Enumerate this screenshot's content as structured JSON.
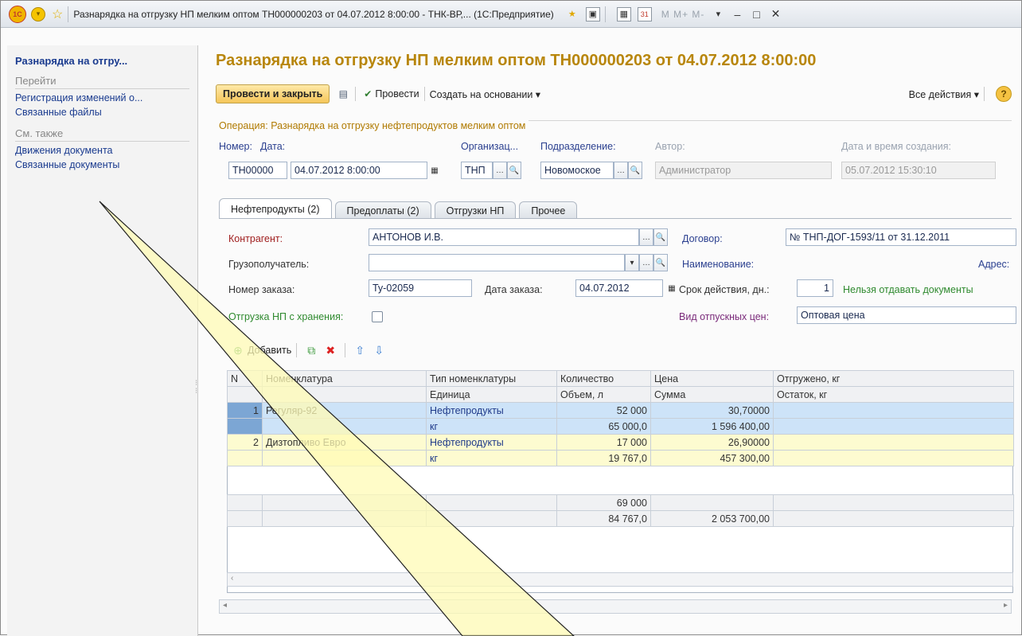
{
  "window": {
    "title": "Разнарядка на отгрузку НП мелким оптом ТН000000203 от 04.07.2012 8:00:00 - ТНК-ВР,... (1С:Предприятие)",
    "memory_buttons": "M  M+  M-",
    "logo": "1С"
  },
  "left_panel": {
    "title": "Разнарядка на отгру...",
    "goto_header": "Перейти",
    "goto_links": [
      "Регистрация изменений о...",
      "Связанные файлы"
    ],
    "see_also_header": "См. также",
    "see_also_links": [
      "Движения документа",
      "Связанные документы"
    ]
  },
  "doc": {
    "title": "Разнарядка на отгрузку НП мелким оптом ТН000000203 от 04.07.2012 8:00:00"
  },
  "toolbar": {
    "post_close": "Провести и закрыть",
    "post": "Провести",
    "create_based": "Создать на основании ▾",
    "all_actions": "Все действия ▾",
    "help": "?"
  },
  "operation": {
    "legend": "Операция: Разнарядка на отгрузку нефтепродуктов мелким оптом",
    "number_label": "Номер:",
    "number_value": "ТН00000",
    "date_label": "Дата:",
    "date_value": "04.07.2012  8:00:00",
    "org_label": "Организац...",
    "org_value": "ТНП",
    "dept_label": "Подразделение:",
    "dept_value": "Новомоское",
    "author_label": "Автор:",
    "author_value": "Администратор",
    "created_label": "Дата и время создания:",
    "created_value": "05.07.2012 15:30:10"
  },
  "tabs": [
    "Нефтепродукты (2)",
    "Предоплаты (2)",
    "Отгрузки НП",
    "Прочее"
  ],
  "form": {
    "counterparty_label": "Контрагент:",
    "counterparty_value": "АНТОНОВ И.В.",
    "contract_label": "Договор:",
    "contract_value": "№ ТНП-ДОГ-1593/11 от 31.12.2011",
    "consignee_label": "Грузополучатель:",
    "consignee_value": "",
    "name_label": "Наименование:",
    "address_label": "Адрес:",
    "order_no_label": "Номер заказа:",
    "order_no_value": "Ту-02059",
    "order_date_label": "Дата заказа:",
    "order_date_value": "04.07.2012",
    "validity_label": "Срок действия, дн.:",
    "validity_value": "1",
    "warning": "Нельзя отдавать документы",
    "storage_label": "Отгрузка НП с хранения:",
    "price_type_label": "Вид отпускных цен:",
    "price_type_value": "Оптовая цена"
  },
  "table_toolbar": {
    "add": "Добавить"
  },
  "grid": {
    "headers_row1": [
      "N",
      "Номенклатура",
      "Тип номенклатуры",
      "Количество",
      "Цена",
      "Отгружено, кг"
    ],
    "headers_row2": [
      "",
      "",
      "Единица",
      "Объем, л",
      "Сумма",
      "Остаток, кг"
    ],
    "rows": [
      {
        "n": "1",
        "item": "Регуляр-92",
        "type": "Нефтепродукты",
        "unit": "кг",
        "qty": "52 000",
        "vol": "65 000,0",
        "price": "30,70000",
        "sum": "1 596 400,00",
        "shipped": "",
        "rest": ""
      },
      {
        "n": "2",
        "item": "Дизтопливо Евро",
        "type": "Нефтепродукты",
        "unit": "кг",
        "qty": "17 000",
        "vol": "19 767,0",
        "price": "26,90000",
        "sum": "457 300,00",
        "shipped": "",
        "rest": ""
      }
    ],
    "totals": {
      "qty": "69 000",
      "vol": "84 767,0",
      "sum": "2 053 700,00"
    }
  },
  "colors": {
    "title_gold": "#b8860b",
    "link_blue": "#1a3b8f",
    "selected_row": "#cde3f8",
    "current_row": "#fdfbd0"
  }
}
